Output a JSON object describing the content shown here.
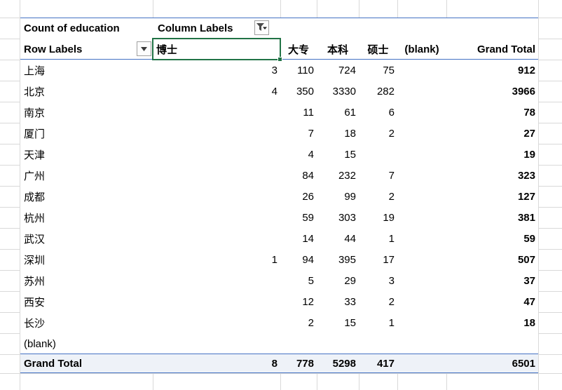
{
  "colors": {
    "selection_green": "#217346",
    "pivot_border_blue": "#4472c4",
    "gridline": "#d9d9d9",
    "grand_total_bg": "#eef2f8"
  },
  "icons": {
    "column_labels_filter": "funnel-with-caret-icon",
    "row_labels_dropdown": "caret-down-icon"
  },
  "pivot": {
    "count_label": "Count of education",
    "column_labels_label": "Column Labels",
    "row_labels_label": "Row Labels",
    "columns": [
      "博士",
      "大专",
      "本科",
      "硕士",
      "(blank)",
      "Grand Total"
    ],
    "rows": [
      {
        "label": "上海",
        "values": [
          "3",
          "110",
          "724",
          "75",
          "",
          "912"
        ]
      },
      {
        "label": "北京",
        "values": [
          "4",
          "350",
          "3330",
          "282",
          "",
          "3966"
        ]
      },
      {
        "label": "南京",
        "values": [
          "",
          "11",
          "61",
          "6",
          "",
          "78"
        ]
      },
      {
        "label": "厦门",
        "values": [
          "",
          "7",
          "18",
          "2",
          "",
          "27"
        ]
      },
      {
        "label": "天津",
        "values": [
          "",
          "4",
          "15",
          "",
          "",
          "19"
        ]
      },
      {
        "label": "广州",
        "values": [
          "",
          "84",
          "232",
          "7",
          "",
          "323"
        ]
      },
      {
        "label": "成都",
        "values": [
          "",
          "26",
          "99",
          "2",
          "",
          "127"
        ]
      },
      {
        "label": "杭州",
        "values": [
          "",
          "59",
          "303",
          "19",
          "",
          "381"
        ]
      },
      {
        "label": "武汉",
        "values": [
          "",
          "14",
          "44",
          "1",
          "",
          "59"
        ]
      },
      {
        "label": "深圳",
        "values": [
          "1",
          "94",
          "395",
          "17",
          "",
          "507"
        ]
      },
      {
        "label": "苏州",
        "values": [
          "",
          "5",
          "29",
          "3",
          "",
          "37"
        ]
      },
      {
        "label": "西安",
        "values": [
          "",
          "12",
          "33",
          "2",
          "",
          "47"
        ]
      },
      {
        "label": "长沙",
        "values": [
          "",
          "2",
          "15",
          "1",
          "",
          "18"
        ]
      },
      {
        "label": "(blank)",
        "values": [
          "",
          "",
          "",
          "",
          "",
          ""
        ]
      }
    ],
    "grand_total": {
      "label": "Grand Total",
      "values": [
        "8",
        "778",
        "5298",
        "417",
        "",
        "6501"
      ]
    }
  }
}
